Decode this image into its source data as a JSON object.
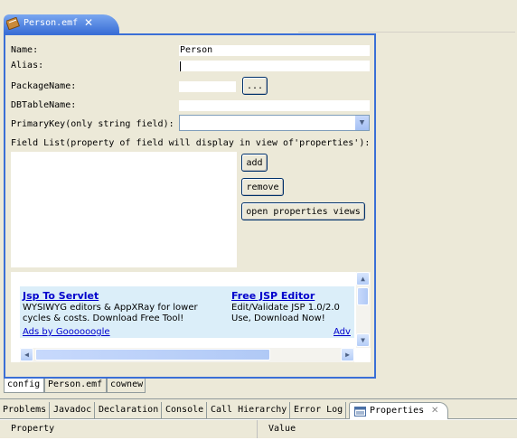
{
  "editor_tab": {
    "title": "Person.emf",
    "close": "✕"
  },
  "form": {
    "name_label": "Name:",
    "name_value": "Person",
    "alias_label": "Alias:",
    "alias_value": "",
    "package_label": "PackageName:",
    "package_value": "",
    "browse_label": "...",
    "dbtable_label": "DBTableName:",
    "dbtable_value": "",
    "pk_label": "PrimaryKey(only string field):",
    "pk_value": "",
    "fieldlist_label": "Field List(property of field will display in view of'properties'):",
    "add_label": "add",
    "remove_label": "remove",
    "open_props_label": "open properties views"
  },
  "ads": {
    "ad1_title": "Jsp To Servlet",
    "ad1_line1": "WYSIWYG editors & AppXRay for lower",
    "ad1_line2": "cycles & costs. Download Free Tool!",
    "ad2_title": "Free JSP Editor",
    "ad2_line1": "Edit/Validate JSP 1.0/2.0",
    "ad2_line2": "Use, Download Now!",
    "by_label": "Ads by Goooooogle",
    "adv_label": "Adv"
  },
  "page_tabs": [
    "config",
    "Person.emf",
    "cownew"
  ],
  "view_tabs": [
    "Problems",
    "Javadoc",
    "Declaration",
    "Console",
    "Call Hierarchy",
    "Error Log",
    "Properties"
  ],
  "view_close": "✕",
  "properties": {
    "col_property": "Property",
    "col_value": "Value"
  },
  "colors": {
    "accent": "#3a6fd6",
    "link": "#0000cc",
    "ad_bg": "#dbeef9",
    "chrome": "#ece9d8"
  }
}
